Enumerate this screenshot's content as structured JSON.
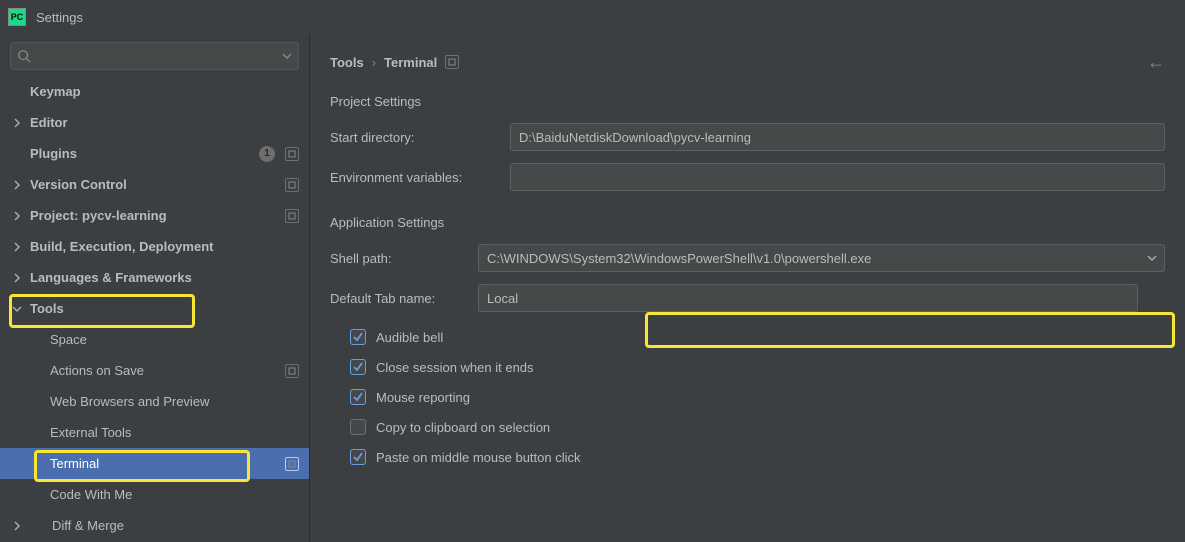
{
  "window": {
    "title": "Settings",
    "app_icon_label": "PC"
  },
  "sidebar": {
    "items": [
      {
        "label": "Keymap",
        "bold": true,
        "indent": 20
      },
      {
        "label": "Editor",
        "bold": true,
        "chev": "right",
        "indent": 4
      },
      {
        "label": "Plugins",
        "bold": true,
        "indent": 20,
        "badge": "1",
        "dots": true
      },
      {
        "label": "Version Control",
        "bold": true,
        "chev": "right",
        "indent": 4,
        "dots": true
      },
      {
        "label": "Project: pycv-learning",
        "bold": true,
        "chev": "right",
        "indent": 4,
        "dots": true
      },
      {
        "label": "Build, Execution, Deployment",
        "bold": true,
        "chev": "right",
        "indent": 4
      },
      {
        "label": "Languages & Frameworks",
        "bold": true,
        "chev": "right",
        "indent": 4
      },
      {
        "label": "Tools",
        "bold": true,
        "chev": "down",
        "indent": 4
      },
      {
        "label": "Space",
        "indent": 40
      },
      {
        "label": "Actions on Save",
        "indent": 40,
        "dots": true
      },
      {
        "label": "Web Browsers and Preview",
        "indent": 40
      },
      {
        "label": "External Tools",
        "indent": 40
      },
      {
        "label": "Terminal",
        "indent": 40,
        "dots": true,
        "selected": true
      },
      {
        "label": "Code With Me",
        "indent": 40
      },
      {
        "label": "Diff & Merge",
        "chev": "right",
        "indent": 26
      }
    ]
  },
  "breadcrumb": {
    "seg1": "Tools",
    "seg2": "Terminal"
  },
  "project_settings": {
    "title": "Project Settings",
    "start_dir_label": "Start directory:",
    "start_dir_value": "D:\\BaiduNetdiskDownload\\pycv-learning",
    "env_vars_label": "Environment variables:",
    "env_vars_value": ""
  },
  "app_settings": {
    "title": "Application Settings",
    "shell_path_label": "Shell path:",
    "shell_path_value": "C:\\WINDOWS\\System32\\WindowsPowerShell\\v1.0\\powershell.exe",
    "default_tab_label": "Default Tab name:",
    "default_tab_value": "Local",
    "checks": [
      {
        "label": "Audible bell",
        "checked": true
      },
      {
        "label": "Close session when it ends",
        "checked": true
      },
      {
        "label": "Mouse reporting",
        "checked": true
      },
      {
        "label": "Copy to clipboard on selection",
        "checked": false
      },
      {
        "label": "Paste on middle mouse button click",
        "checked": true
      }
    ]
  }
}
